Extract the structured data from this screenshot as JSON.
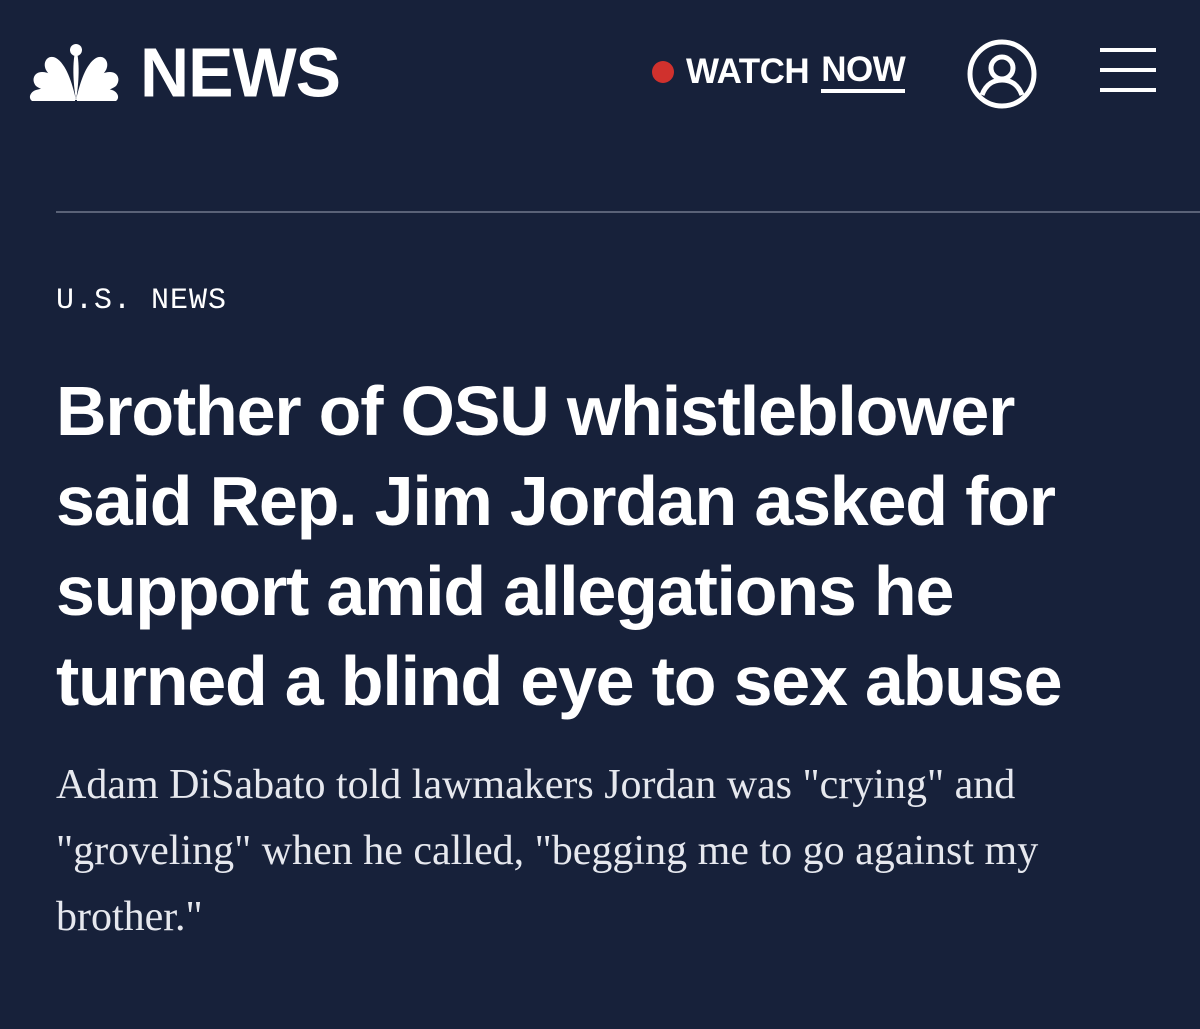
{
  "brand": {
    "wordmark": "NEWS",
    "logo_icon": "nbc-peacock-icon",
    "colors": {
      "background": "#17213a",
      "text": "#ffffff",
      "live_dot": "#d0312d",
      "divider": "#5a6277"
    }
  },
  "header": {
    "watch_label": "WATCH",
    "watch_now_label": "NOW",
    "live_indicator_icon": "live-dot-icon",
    "account_icon": "user-account-icon",
    "menu_icon": "hamburger-menu-icon"
  },
  "article": {
    "section": "U.S. NEWS",
    "headline": "Brother of OSU whistleblower said Rep. Jim Jordan asked for support amid allegations he turned a blind eye to sex abuse",
    "dek": "Adam DiSabato told lawmakers Jordan was \"crying\" and \"groveling\" when he called, \"begging me to go against my brother.\""
  }
}
